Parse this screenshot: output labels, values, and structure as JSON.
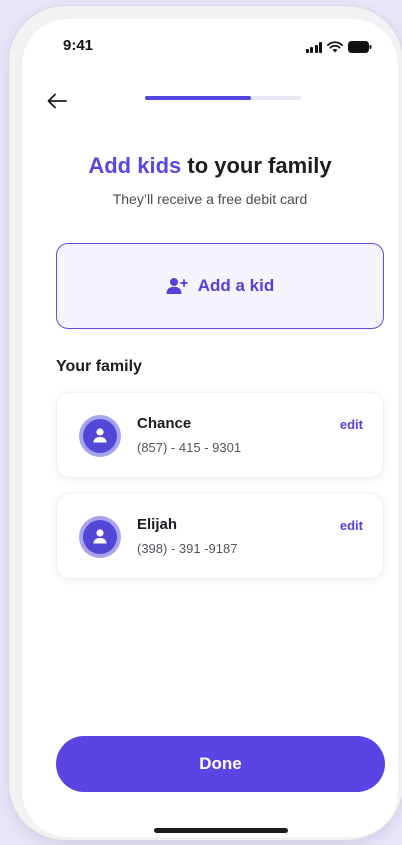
{
  "status_bar": {
    "time": "9:41",
    "icons": [
      "signal-icon",
      "wifi-icon",
      "battery-icon"
    ]
  },
  "header": {
    "back_icon": "arrow-left-icon",
    "progress": 0.68
  },
  "title": {
    "accent": "Add kids",
    "rest": " to your family"
  },
  "subtitle": "They’ll receive a free debit card",
  "add_kid": {
    "icon": "add-user-icon",
    "label": "Add a kid"
  },
  "family": {
    "section_title": "Your family",
    "members": [
      {
        "name": "Chance",
        "phone": "(857) - 415 - 9301",
        "edit_label": "edit"
      },
      {
        "name": "Elijah",
        "phone": "(398) - 391 -9187",
        "edit_label": "edit"
      }
    ]
  },
  "done_label": "Done",
  "colors": {
    "accent": "#5A44E4",
    "background": "#E7E5F7",
    "avatar_ring": "#A9A4EC"
  }
}
